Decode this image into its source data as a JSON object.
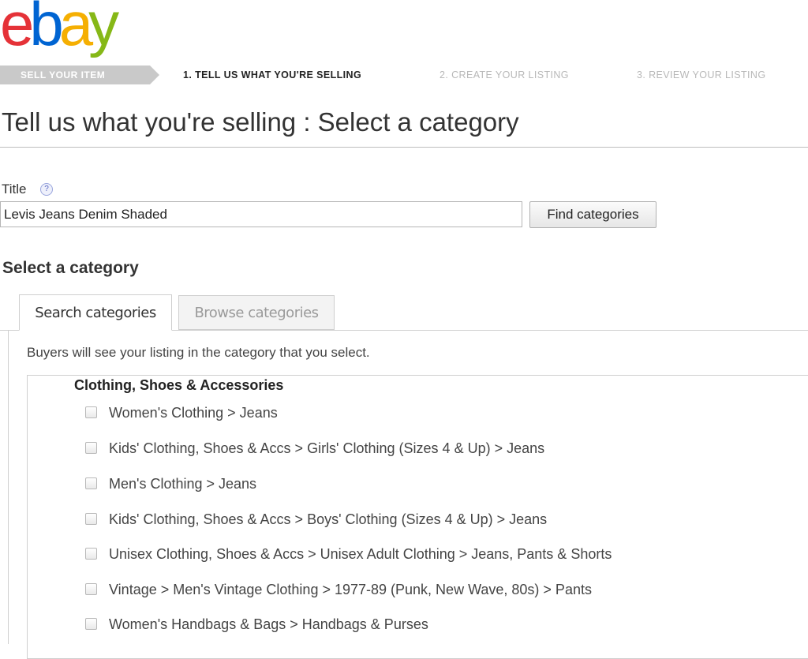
{
  "logo": {
    "letters": [
      "e",
      "b",
      "a",
      "y"
    ],
    "colors": [
      "#e53238",
      "#0064d2",
      "#f5af02",
      "#86b817"
    ]
  },
  "steps": {
    "current": "SELL YOUR ITEM",
    "step1": "1. TELL US WHAT YOU'RE SELLING",
    "step2": "2. CREATE YOUR LISTING",
    "step3": "3. REVIEW YOUR LISTING"
  },
  "page_title": "Tell us what you're selling : Select a category",
  "title_field": {
    "label": "Title",
    "help_icon": "?",
    "value": "Levis Jeans Denim Shaded",
    "button": "Find categories"
  },
  "section_heading": "Select a category",
  "tabs": {
    "search": "Search categories",
    "browse": "Browse categories"
  },
  "helper_text": "Buyers will see your listing in the category that you select.",
  "results": {
    "group": "Clothing, Shoes & Accessories",
    "items": [
      "Women's Clothing > Jeans",
      "Kids' Clothing, Shoes & Accs > Girls' Clothing (Sizes 4 & Up) > Jeans",
      "Men's Clothing > Jeans",
      "Kids' Clothing, Shoes & Accs > Boys' Clothing (Sizes 4 & Up) > Jeans",
      "Unisex Clothing, Shoes & Accs > Unisex Adult Clothing > Jeans, Pants & Shorts",
      "Vintage > Men's Vintage Clothing > 1977-89 (Punk, New Wave, 80s) > Pants",
      "Women's Handbags & Bags > Handbags & Purses"
    ]
  }
}
